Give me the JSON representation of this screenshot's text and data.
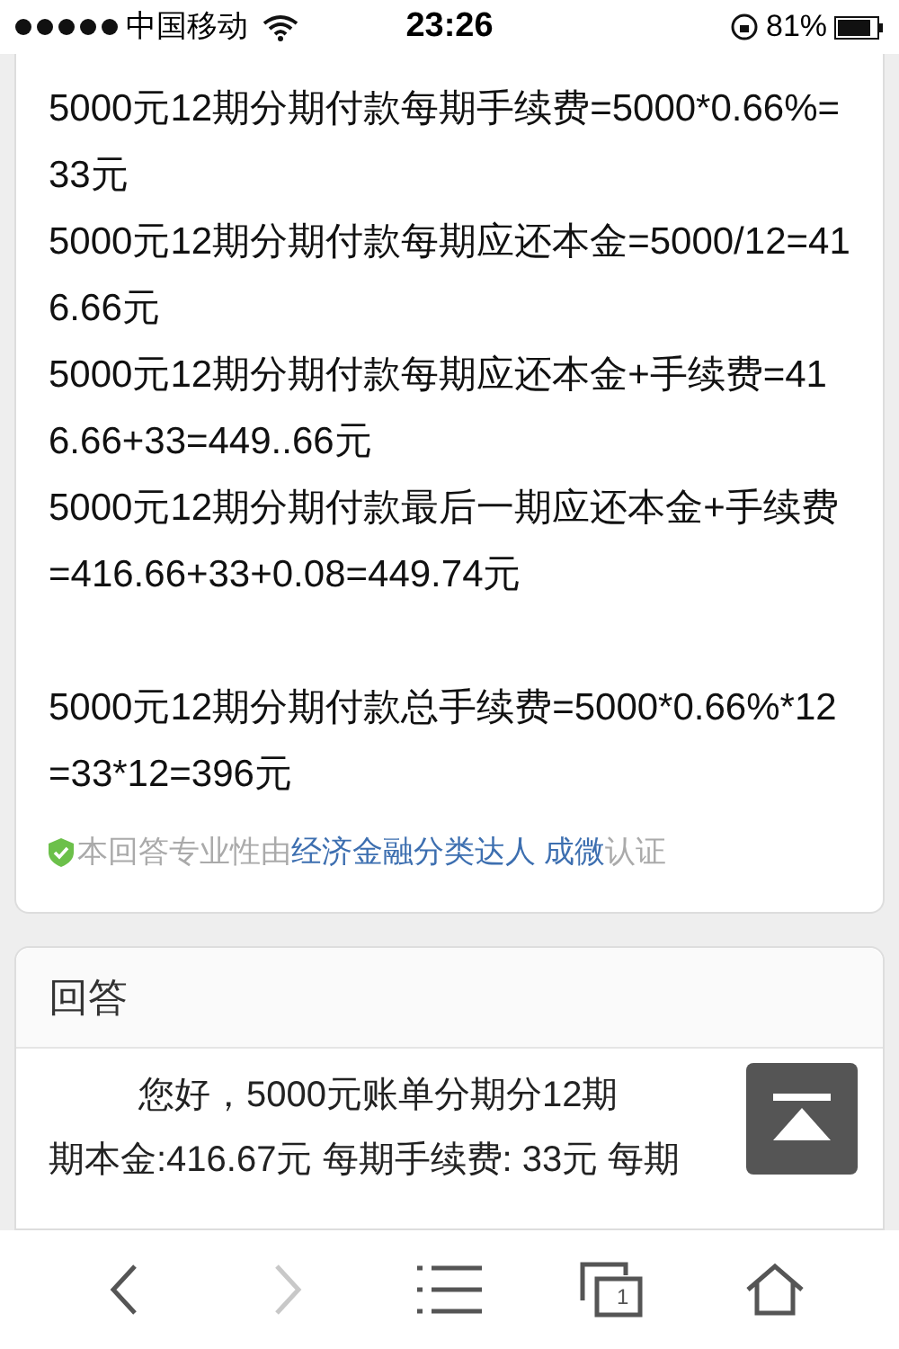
{
  "status_bar": {
    "carrier": "中国移动",
    "time": "23:26",
    "battery": "81%"
  },
  "answer_card": {
    "paragraphs": [
      {
        "text": "5000元12期分期付款每期手续费=5000*0.66%=33元",
        "spaced_before": false
      },
      {
        "text": "5000元12期分期付款每期应还本金=5000/12=416.66元",
        "spaced_before": false
      },
      {
        "text": "5000元12期分期付款每期应还本金+手续费=416.66+33=449..66元",
        "spaced_before": false
      },
      {
        "text": "5000元12期分期付款最后一期应还本金+手续费=416.66+33+0.08=449.74元",
        "spaced_before": false
      },
      {
        "text": "5000元12期分期付款总手续费=5000*0.66%*12=33*12=396元",
        "spaced_before": true
      }
    ],
    "certification": {
      "prefix": "本回答专业性由",
      "expert": "经济金融分类达人 成微",
      "suffix": "认证"
    }
  },
  "second_card": {
    "title": "回答",
    "lines": [
      "您好，5000元账单分期分12期",
      "期本金:416.67元 每期手续费: 33元 每期"
    ]
  },
  "toolbar": [
    {
      "kind": "back",
      "disabled": false
    },
    {
      "kind": "forward",
      "disabled": true
    },
    {
      "kind": "menu",
      "disabled": false
    },
    {
      "kind": "tabs",
      "disabled": false,
      "count": "1"
    },
    {
      "kind": "home",
      "disabled": false
    }
  ]
}
